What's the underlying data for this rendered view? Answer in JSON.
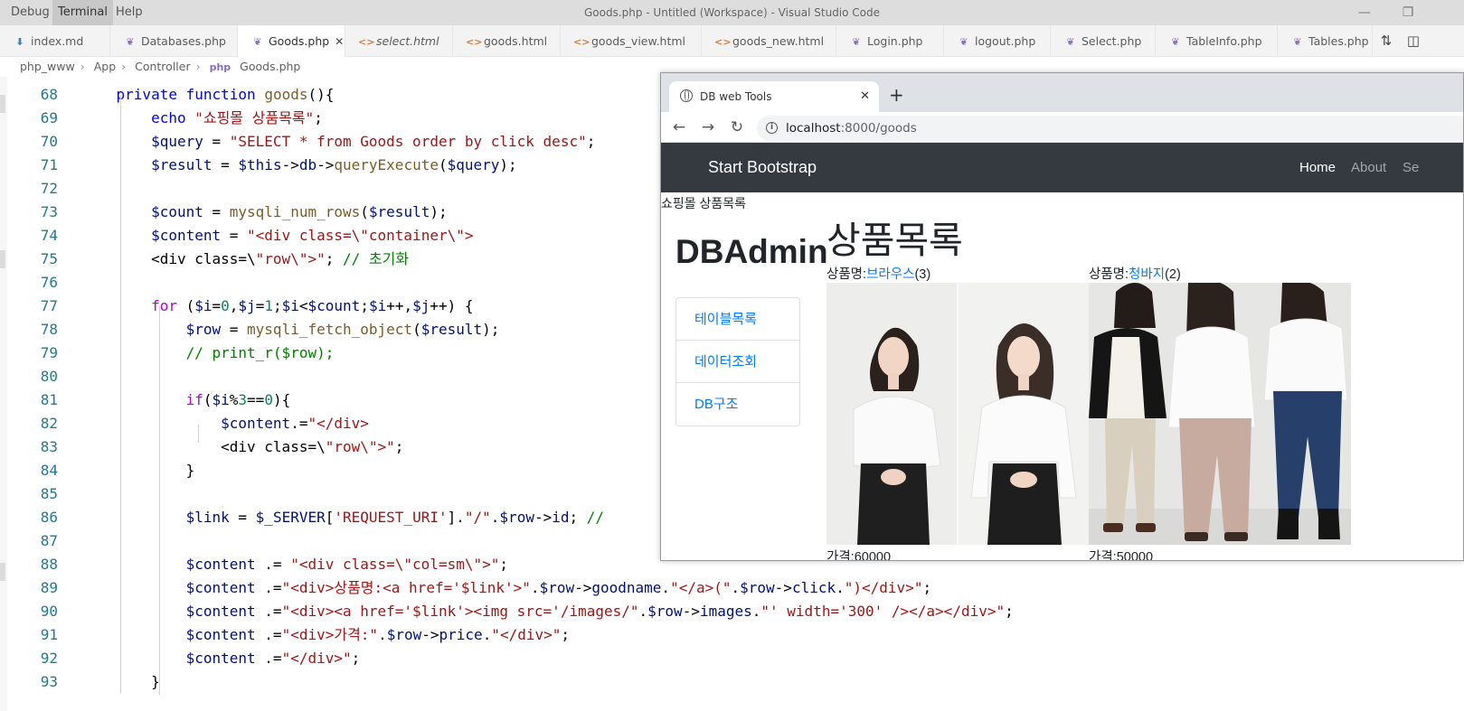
{
  "titlebar": {
    "menu": [
      "Debug",
      "Terminal",
      "Help"
    ],
    "active_menu": "Terminal",
    "window_title": "Goods.php - Untitled (Workspace) - Visual Studio Code"
  },
  "tabs": [
    {
      "icon": "markdown-icon",
      "glyph": "⬇",
      "kind": "md",
      "label": "index.md",
      "italic": false
    },
    {
      "icon": "php-icon",
      "glyph": "php",
      "kind": "php",
      "label": "Databases.php",
      "italic": false
    },
    {
      "icon": "php-icon",
      "glyph": "php",
      "kind": "php",
      "label": "Goods.php",
      "italic": false,
      "active": true
    },
    {
      "icon": "html-icon",
      "glyph": "<>",
      "kind": "html",
      "label": "select.html",
      "italic": true
    },
    {
      "icon": "html-icon",
      "glyph": "<>",
      "kind": "html",
      "label": "goods.html",
      "italic": false
    },
    {
      "icon": "html-icon",
      "glyph": "<>",
      "kind": "html",
      "label": "goods_view.html",
      "italic": false
    },
    {
      "icon": "html-icon",
      "glyph": "<>",
      "kind": "html",
      "label": "goods_new.html",
      "italic": false
    },
    {
      "icon": "php-icon",
      "glyph": "php",
      "kind": "php",
      "label": "Login.php",
      "italic": false
    },
    {
      "icon": "php-icon",
      "glyph": "php",
      "kind": "php",
      "label": "logout.php",
      "italic": false
    },
    {
      "icon": "php-icon",
      "glyph": "php",
      "kind": "php",
      "label": "Select.php",
      "italic": false
    },
    {
      "icon": "php-icon",
      "glyph": "php",
      "kind": "php",
      "label": "TableInfo.php",
      "italic": false
    },
    {
      "icon": "php-icon",
      "glyph": "php",
      "kind": "php",
      "label": "Tables.php",
      "italic": false
    }
  ],
  "breadcrumb": [
    "php_www",
    "App",
    "Controller",
    "Goods.php"
  ],
  "editor": {
    "lines": [
      {
        "n": "68",
        "code": "    private function goods(){"
      },
      {
        "n": "69",
        "code": "        echo \"쇼핑몰 상품목록\";"
      },
      {
        "n": "70",
        "code": "        $query = \"SELECT * from Goods order by click desc\";"
      },
      {
        "n": "71",
        "code": "        $result = $this->db->queryExecute($query);"
      },
      {
        "n": "72",
        "code": ""
      },
      {
        "n": "73",
        "code": "        $count = mysqli_num_rows($result);"
      },
      {
        "n": "74",
        "code": "        $content = \"<div class=\\\"container\\\">"
      },
      {
        "n": "75",
        "code": "        <div class=\\\"row\\\">\"; // 초기화"
      },
      {
        "n": "76",
        "code": ""
      },
      {
        "n": "77",
        "code": "        for ($i=0,$j=1;$i<$count;$i++,$j++) {"
      },
      {
        "n": "78",
        "code": "            $row = mysqli_fetch_object($result);"
      },
      {
        "n": "79",
        "code": "            // print_r($row);"
      },
      {
        "n": "80",
        "code": ""
      },
      {
        "n": "81",
        "code": "            if($i%3==0){"
      },
      {
        "n": "82",
        "code": "                $content.=\"</div>"
      },
      {
        "n": "83",
        "code": "                <div class=\\\"row\\\">\";"
      },
      {
        "n": "84",
        "code": "            }"
      },
      {
        "n": "85",
        "code": ""
      },
      {
        "n": "86",
        "code": "            $link = $_SERVER['REQUEST_URI'].\"/\".$row->id; //"
      },
      {
        "n": "87",
        "code": ""
      },
      {
        "n": "88",
        "code": "            $content .= \"<div class=\\\"col=sm\\\">\";"
      },
      {
        "n": "89",
        "code": "            $content .=\"<div>상품명:<a href='$link'>\".$row->goodname.\"</a>(\".$row->click.\")</div>\";"
      },
      {
        "n": "90",
        "code": "            $content .=\"<div><a href='$link'><img src='/images/\".$row->images.\"' width='300' /></a></div>\";"
      },
      {
        "n": "91",
        "code": "            $content .=\"<div>가격:\".$row->price.\"</div>\";"
      },
      {
        "n": "92",
        "code": "            $content .=\"</div>\";"
      },
      {
        "n": "93",
        "code": "        }"
      }
    ]
  },
  "browser": {
    "tab_title": "DB web Tools",
    "url_host": "localhost",
    "url_rest": ":8000/goods",
    "page": {
      "brand": "Start Bootstrap",
      "nav": [
        "Home",
        "About",
        "Se"
      ],
      "echo": "쇼핑몰 상품목록",
      "sidebar_title": "DBAdmin",
      "sidebar_items": [
        "테이블목록",
        "데이터조회",
        "DB구조"
      ],
      "goods_title": "상품목록",
      "goods": [
        {
          "name_label": "상품명:",
          "name": "브라우스",
          "click": "(3)",
          "price": "가격:60000"
        },
        {
          "name_label": "상품명:",
          "name": "청바지",
          "click": "(2)",
          "price": "가격:50000"
        }
      ]
    }
  },
  "colors": {
    "keyword": "#0000ff",
    "control": "#af00db",
    "function": "#795e26",
    "variable": "#001080",
    "string": "#a31515",
    "comment": "#008000",
    "navbar": "#343a40",
    "link": "#007bff"
  }
}
